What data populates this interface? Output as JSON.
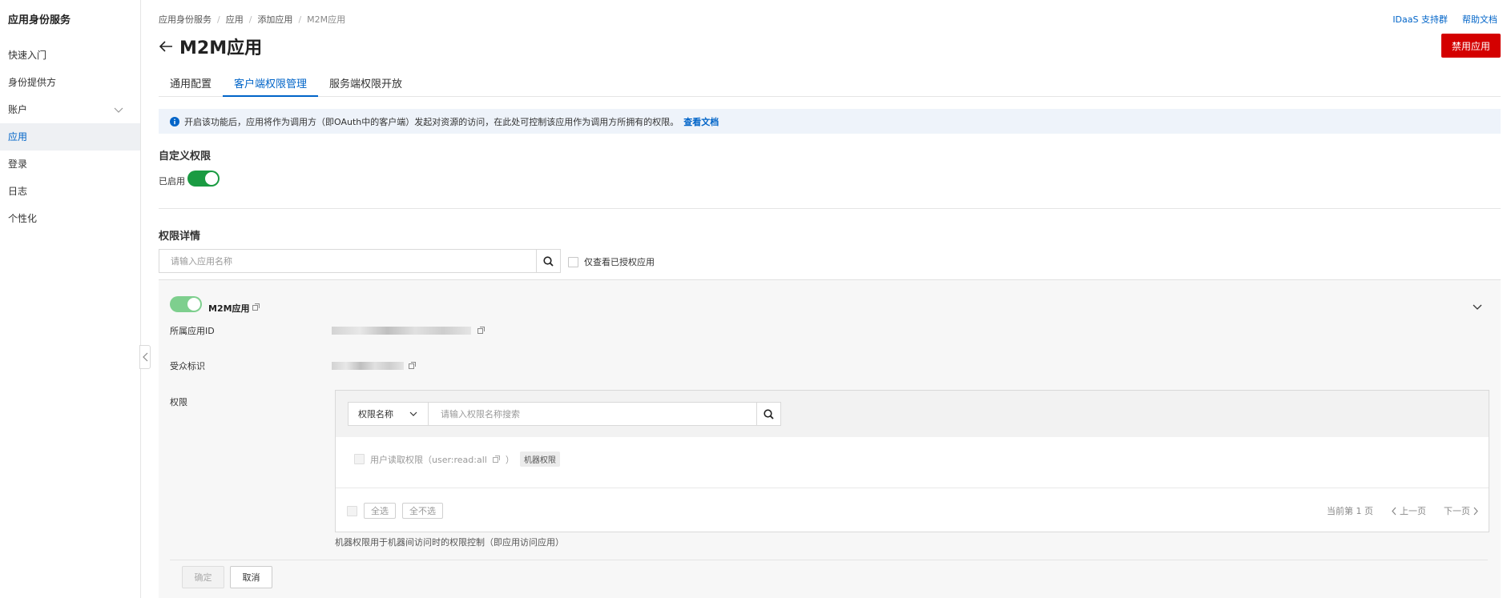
{
  "sidebar": {
    "title": "应用身份服务",
    "items": [
      {
        "label": "快速入门"
      },
      {
        "label": "身份提供方"
      },
      {
        "label": "账户"
      },
      {
        "label": "应用"
      },
      {
        "label": "登录"
      },
      {
        "label": "日志"
      },
      {
        "label": "个性化"
      }
    ]
  },
  "breadcrumb": [
    "应用身份服务",
    "应用",
    "添加应用",
    "M2M应用"
  ],
  "top_links": {
    "support": "IDaaS 支持群",
    "help": "帮助文档"
  },
  "header": {
    "title": "M2M应用",
    "disable_button": "禁用应用"
  },
  "tabs": [
    "通用配置",
    "客户端权限管理",
    "服务端权限开放"
  ],
  "info": {
    "text": "开启该功能后，应用将作为调用方（即OAuth中的客户端）发起对资源的访问，在此处可控制该应用作为调用方所拥有的权限。",
    "link": "查看文档"
  },
  "custom_permission": {
    "title": "自定义权限",
    "status_label": "已启用"
  },
  "permission_details": {
    "title": "权限详情",
    "search_placeholder": "请输入应用名称",
    "only_authorized": "仅查看已授权应用"
  },
  "app_panel": {
    "app_name": "M2M应用",
    "app_id_label": "所属应用ID",
    "audience_label": "受众标识",
    "permission_label": "权限",
    "filter_select": "权限名称",
    "filter_placeholder": "请输入权限名称搜索",
    "permission_item": "用户读取权限（user:read:all",
    "permission_item_suffix": "）",
    "permission_tag": "机器权限",
    "select_all": "全选",
    "select_none": "全不选",
    "page_info": "当前第 1 页",
    "prev": "上一页",
    "next": "下一页",
    "note": "机器权限用于机器间访问时的权限控制（即应用访问应用）"
  },
  "actions": {
    "ok": "确定",
    "cancel": "取消"
  },
  "colors": {
    "accent": "#0064c8",
    "danger": "#d40000",
    "switch_on": "#1a9b42"
  }
}
